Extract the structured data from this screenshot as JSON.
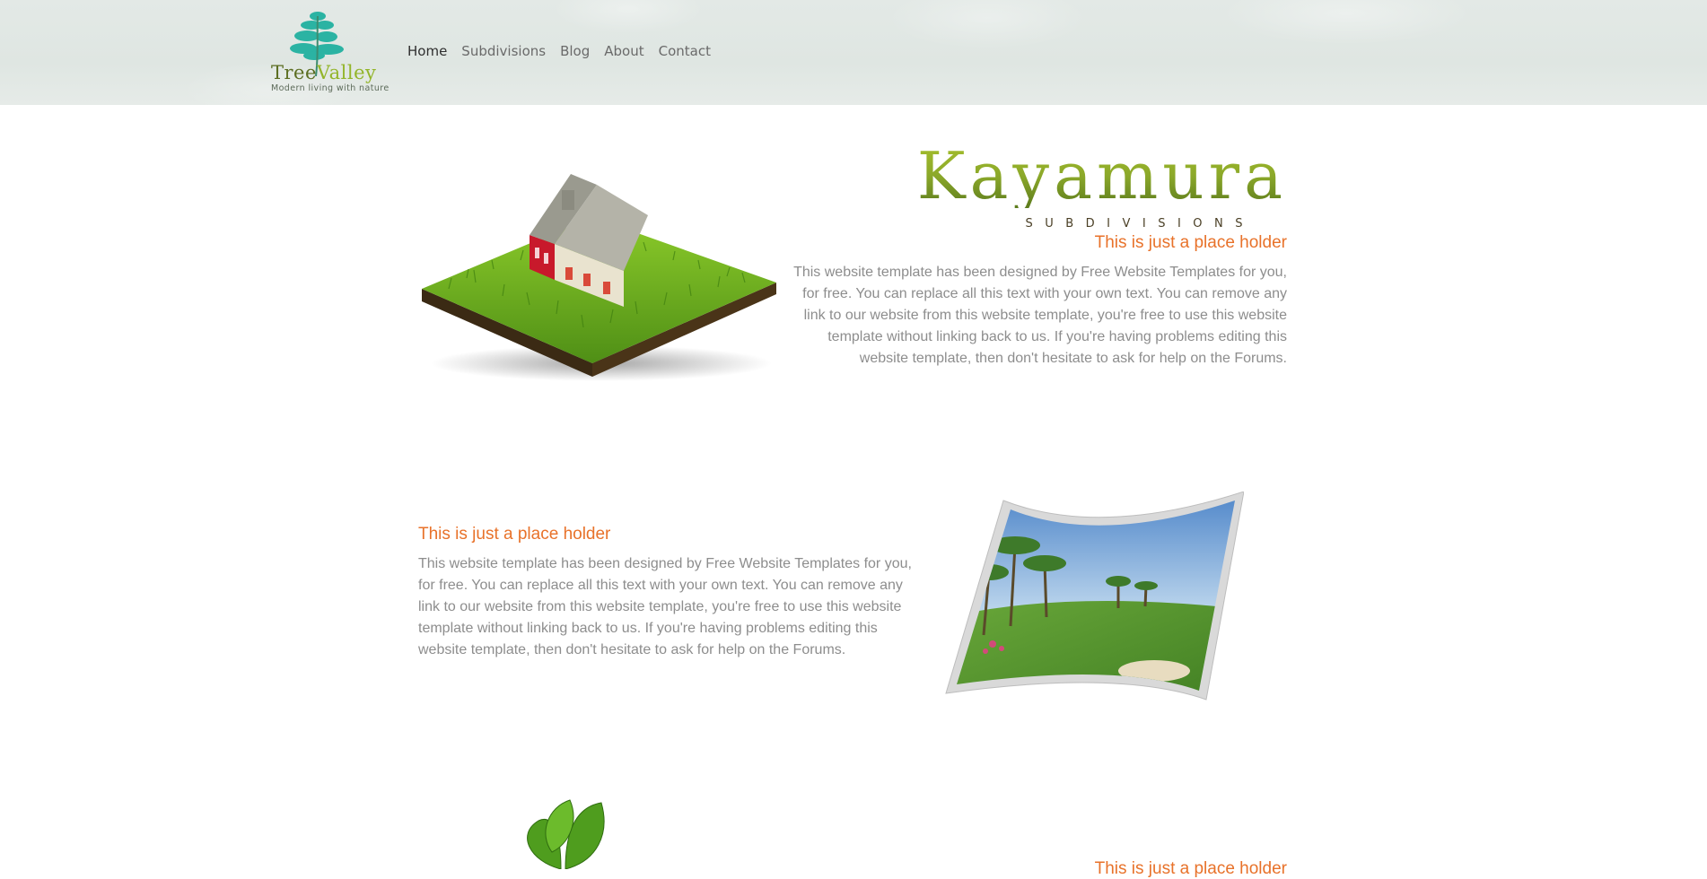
{
  "header": {
    "logo": {
      "word_1": "Tree",
      "word_2": "Valley",
      "tagline": "Modern living with nature",
      "icon": "tree-icon"
    },
    "nav": [
      {
        "label": "Home",
        "active": true
      },
      {
        "label": "Subdivisions",
        "active": false
      },
      {
        "label": "Blog",
        "active": false
      },
      {
        "label": "About",
        "active": false
      },
      {
        "label": "Contact",
        "active": false
      }
    ]
  },
  "hero": {
    "brand_title": "Kayamura",
    "brand_subtitle": "SUBDIVISIONS",
    "heading": "This is just a place holder",
    "text": "This website template has been designed by Free Website Templates for you, for free. You can replace all this text with your own text. You can remove any link to our website from this website template, you're free to use this website template without linking back to us. If you're having problems editing this website template, then don't hesitate to ask for help on the Forums."
  },
  "section_2": {
    "heading": "This is just a place holder",
    "text": "This website template has been designed by Free Website Templates for you, for free. You can replace all this text with your own text. You can remove any link to our website from this website template, you're free to use this website template without linking back to us. If you're having problems editing this website template, then don't hesitate to ask for help on the Forums."
  },
  "section_3": {
    "heading": "This is just a place holder"
  },
  "colors": {
    "accent_orange": "#e8722a",
    "brand_green": "#8ba82a",
    "body_text": "#8d8d8d"
  }
}
